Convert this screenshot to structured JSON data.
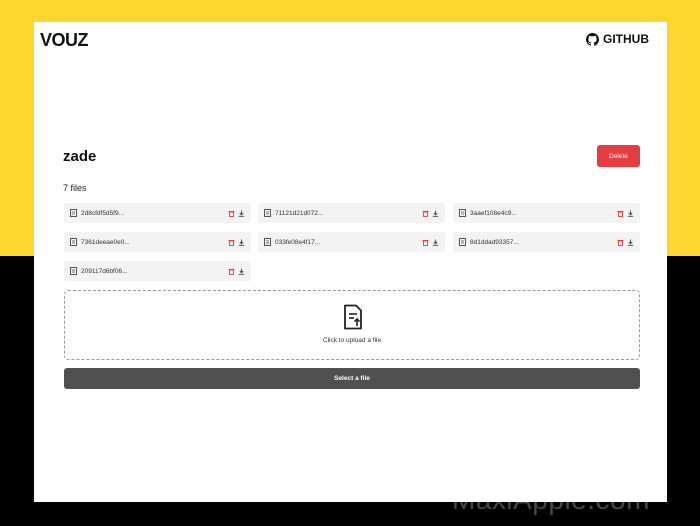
{
  "brand": {
    "logo": "VOUZ",
    "github_label": "GITHUB"
  },
  "folder": {
    "title": "zade",
    "delete_label": "Delete",
    "file_count": "7 files"
  },
  "files": [
    {
      "name": "2d8cfdf5d5f9..."
    },
    {
      "name": "71121d21d072..."
    },
    {
      "name": "3aaef108e4c9..."
    },
    {
      "name": "7361deeae0e0..."
    },
    {
      "name": "033fe08e4f17..."
    },
    {
      "name": "8d1ddad93357..."
    },
    {
      "name": "209117d6bf06..."
    }
  ],
  "upload": {
    "prompt": "Click to upload a file",
    "select_label": "Select a file"
  },
  "watermark": "MaxiApple.com",
  "colors": {
    "background_top": "#fdd52f",
    "background_bottom": "#000000",
    "delete": "#e33d41",
    "select_button": "#505050"
  }
}
